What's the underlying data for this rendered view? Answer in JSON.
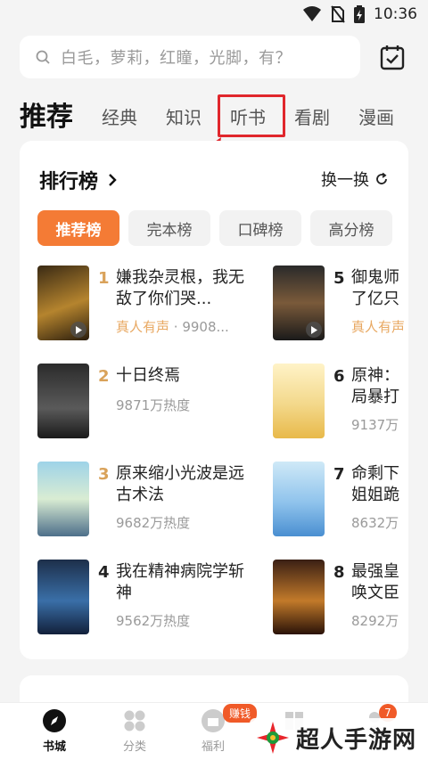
{
  "status_bar": {
    "time": "10:36"
  },
  "search": {
    "placeholder": "白毛，萝莉，红瞳，光脚，有？"
  },
  "tabs": [
    {
      "label": "推荐"
    },
    {
      "label": "经典"
    },
    {
      "label": "知识"
    },
    {
      "label": "听书"
    },
    {
      "label": "看剧"
    },
    {
      "label": "漫画"
    }
  ],
  "ranking": {
    "title": "排行榜",
    "swap_label": "换一换",
    "filters": [
      {
        "label": "推荐榜"
      },
      {
        "label": "完本榜"
      },
      {
        "label": "口碑榜"
      },
      {
        "label": "高分榜"
      }
    ],
    "books": [
      {
        "rank": "1",
        "title": "嫌我杂灵根，我无敌了你们哭...",
        "tag": "真人有声",
        "meta": " · 9908..."
      },
      {
        "rank": "2",
        "title": "十日终焉",
        "meta": "9871万热度"
      },
      {
        "rank": "3",
        "title": "原来缩小光波是远古术法",
        "meta": "9682万热度"
      },
      {
        "rank": "4",
        "title": "我在精神病院学斩神",
        "meta": "9562万热度"
      },
      {
        "rank": "5",
        "title": "御鬼师了亿只",
        "tag": "真人有声"
      },
      {
        "rank": "6",
        "title": "原神：局暴打",
        "meta": "9137万"
      },
      {
        "rank": "7",
        "title": "命剩下姐姐跪",
        "meta": "8632万"
      },
      {
        "rank": "8",
        "title": "最强皇唤文臣",
        "meta": "8292万"
      }
    ]
  },
  "bottom_nav": {
    "items": [
      {
        "label": "书城"
      },
      {
        "label": "分类"
      },
      {
        "label": "福利"
      },
      {
        "label": ""
      },
      {
        "label": ""
      }
    ],
    "earn_badge": "赚钱",
    "count_badge": "7"
  },
  "watermark": {
    "text": "超人手游网"
  },
  "colors": {
    "accent": "#f47b35",
    "highlight": "#e0262c",
    "rank_gold": "#d9a25a"
  }
}
